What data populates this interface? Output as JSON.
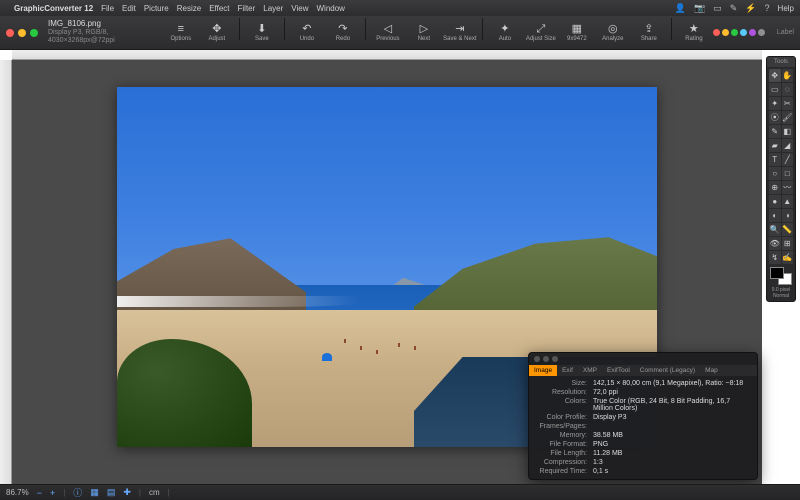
{
  "menubar": {
    "app": "GraphicConverter 12",
    "items": [
      "File",
      "Edit",
      "Picture",
      "Resize",
      "Effect",
      "Filter",
      "Layer",
      "View",
      "Window"
    ],
    "help": "Help"
  },
  "document": {
    "title": "IMG_8106.png",
    "subtitle": "Display P3, RGB/8, 4030×3268px@72ppi"
  },
  "toolbar": {
    "options": "Options",
    "adjust": "Adjust",
    "save": "Save",
    "undo": "Undo",
    "redo": "Redo",
    "previous": "Previous",
    "next": "Next",
    "savenext": "Save & Next",
    "auto": "Auto",
    "adjustsize": "Adjust Size",
    "9x9472": "9x9472",
    "analyze": "Analyze",
    "share": "Share",
    "rating": "Rating",
    "label": "Label"
  },
  "toolsPalette": {
    "title": "Tools",
    "brushSize": "9.0 pixel",
    "mode": "Normal"
  },
  "infoPanel": {
    "tabs": [
      "Image",
      "Exif",
      "XMP",
      "ExifTool",
      "Comment (Legacy)",
      "Map"
    ],
    "rows": [
      {
        "k": "Size:",
        "v": "142,15 × 80,00 cm (9,1 Megapixel), Ratio: ~8:18"
      },
      {
        "k": "Resolution:",
        "v": "72,0 ppi"
      },
      {
        "k": "Colors:",
        "v": "True Color (RGB, 24 Bit, 8 Bit Padding, 16,7 Million Colors)"
      },
      {
        "k": "Color Profile:",
        "v": "Display P3"
      },
      {
        "k": "Frames/Pages:",
        "v": ""
      },
      {
        "k": "Memory:",
        "v": "38.58 MB"
      },
      {
        "k": "File Format:",
        "v": "PNG"
      },
      {
        "k": "File Length:",
        "v": "11.28 MB"
      },
      {
        "k": "Compression:",
        "v": "1:3"
      },
      {
        "k": "Required Time:",
        "v": "0,1 s"
      }
    ]
  },
  "status": {
    "zoom": "86.7%",
    "unit": "cm"
  },
  "dots": [
    "#ff5f57",
    "#febc2e",
    "#28c840",
    "#5ac8fa",
    "#af52de",
    "#8e8e93"
  ]
}
